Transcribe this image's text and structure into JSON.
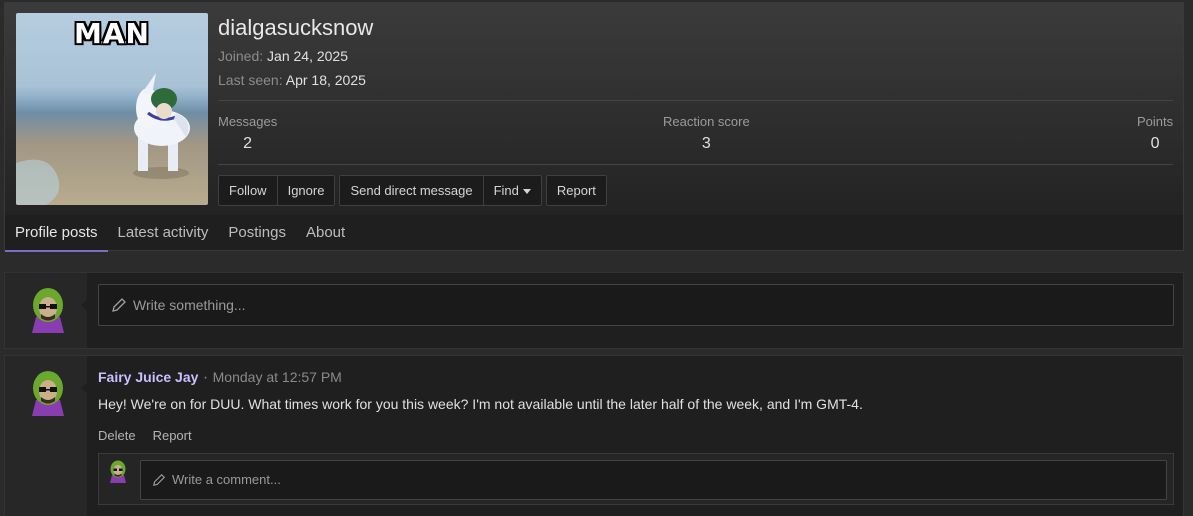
{
  "profile": {
    "avatar_caption": "MAN",
    "username": "dialgasucksnow",
    "joined_label": "Joined:",
    "joined_value": "Jan 24, 2025",
    "last_seen_label": "Last seen:",
    "last_seen_value": "Apr 18, 2025",
    "stats": [
      {
        "label": "Messages",
        "value": "2"
      },
      {
        "label": "Reaction score",
        "value": "3"
      },
      {
        "label": "Points",
        "value": "0"
      }
    ],
    "buttons": {
      "follow": "Follow",
      "ignore": "Ignore",
      "send_dm": "Send direct message",
      "find": "Find",
      "report": "Report"
    }
  },
  "tabs": [
    "Profile posts",
    "Latest activity",
    "Postings",
    "About"
  ],
  "composer": {
    "placeholder": "Write something..."
  },
  "post": {
    "author": "Fairy Juice Jay",
    "separator": "·",
    "time": "Monday at 12:57 PM",
    "text": "Hey! We're on for DUU. What times work for you this week? I'm not available until the later half of the week, and I'm GMT-4.",
    "actions": {
      "delete": "Delete",
      "report": "Report"
    },
    "comment_placeholder": "Write a comment..."
  },
  "colors": {
    "accent": "#7b6cc4",
    "author": "#c9bfff"
  }
}
